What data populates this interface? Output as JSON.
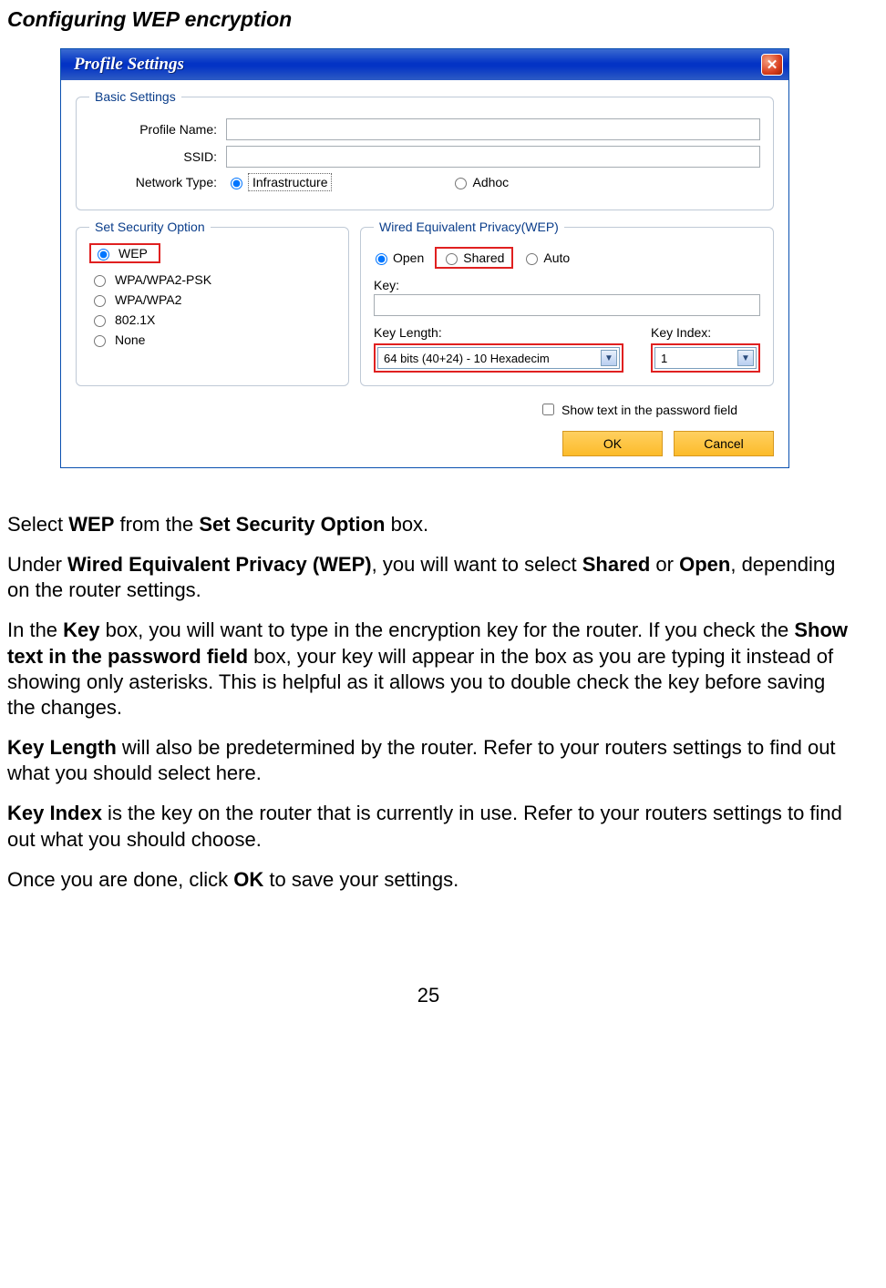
{
  "heading": "Configuring WEP encryption",
  "window": {
    "title": "Profile Settings",
    "basic": {
      "legend": "Basic Settings",
      "profileNameLabel": "Profile Name:",
      "profileNameValue": "",
      "ssidLabel": "SSID:",
      "ssidValue": "",
      "networkTypeLabel": "Network Type:",
      "infraLabel": "Infrastructure",
      "adhocLabel": "Adhoc"
    },
    "security": {
      "legend": "Set Security Option",
      "wep": "WEP",
      "wpapsk": "WPA/WPA2-PSK",
      "wpa": "WPA/WPA2",
      "dot1x": "802.1X",
      "none": "None"
    },
    "wep": {
      "legend": "Wired Equivalent Privacy(WEP)",
      "open": "Open",
      "shared": "Shared",
      "auto": "Auto",
      "keyLabel": "Key:",
      "keyValue": "",
      "keyLengthLabel": "Key Length:",
      "keyLengthValue": "64 bits (40+24) - 10 Hexadecim",
      "keyIndexLabel": "Key Index:",
      "keyIndexValue": "1"
    },
    "showText": "Show text in the password field",
    "okLabel": "OK",
    "cancelLabel": "Cancel"
  },
  "doc": {
    "p1a": "Select ",
    "p1b": "WEP",
    "p1c": " from the ",
    "p1d": "Set Security Option",
    "p1e": " box.",
    "p2a": "Under ",
    "p2b": "Wired Equivalent Privacy (WEP)",
    "p2c": ", you will want to select ",
    "p2d": "Shared",
    "p2e": " or ",
    "p2f": "Open",
    "p2g": ", depending on the router settings.",
    "p3a": "In the ",
    "p3b": "Key",
    "p3c": " box, you will want to type in the encryption key for the router.  If you check the ",
    "p3d": "Show text in the password field",
    "p3e": " box, your key will appear in the box as you are typing it instead of showing only asterisks.  This is helpful as it allows you to double check the key before saving the changes.",
    "p4a": "Key Length",
    "p4b": " will also be predetermined by the router.  Refer to your routers settings to find out what you should select here.",
    "p5a": "Key Index",
    "p5b": " is the key on the router that is currently in use.  Refer to your routers settings to find out what you should choose.",
    "p6a": "Once you are done, click ",
    "p6b": "OK",
    "p6c": " to save your settings."
  },
  "pageNumber": "25"
}
